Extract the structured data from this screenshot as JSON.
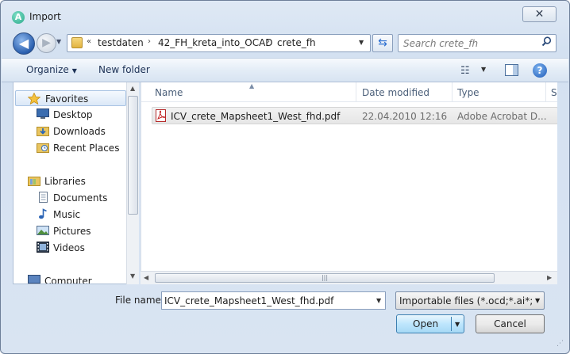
{
  "window": {
    "title": "Import",
    "app_icon_letter": "A",
    "close_glyph": "✕"
  },
  "nav": {
    "back_glyph": "◀",
    "forward_glyph": "▶",
    "history_glyph": "▼"
  },
  "address": {
    "overflow": "«",
    "crumbs": [
      "testdaten",
      "42_FH_kreta_into_OCAD",
      "crete_fh"
    ],
    "separator": "›",
    "dropdown_glyph": "▼",
    "refresh_glyph": "⇆"
  },
  "search": {
    "placeholder": "Search crete_fh",
    "icon": "magnifier"
  },
  "toolbar": {
    "organize_label": "Organize",
    "organize_arrow": "▼",
    "new_folder_label": "New folder",
    "views_glyph": "☷",
    "views_dd": "▼",
    "help_glyph": "?"
  },
  "sidebar": {
    "favorites_label": "Favorites",
    "favorites": [
      "Desktop",
      "Downloads",
      "Recent Places"
    ],
    "libraries_label": "Libraries",
    "libraries": [
      "Documents",
      "Music",
      "Pictures",
      "Videos"
    ],
    "computer_label": "Computer"
  },
  "files": {
    "columns": [
      "Name",
      "Date modified",
      "Type",
      "Si"
    ],
    "sort_glyph": "▲",
    "rows": [
      {
        "name": "ICV_crete_Mapsheet1_West_fhd.pdf",
        "date": "22.04.2010 12:16",
        "type": "Adobe Acrobat D..."
      }
    ]
  },
  "bottom": {
    "filename_label": "File name:",
    "filename_value": "ICV_crete_Mapsheet1_West_fhd.pdf",
    "filter_value": "Importable files (*.ocd;*.ai*;*.pdf",
    "open_label": "Open",
    "cancel_label": "Cancel"
  },
  "colors": {
    "accent": "#2a5fae",
    "selection": "#e6e6e6",
    "pdf_red": "#c21d1d"
  }
}
